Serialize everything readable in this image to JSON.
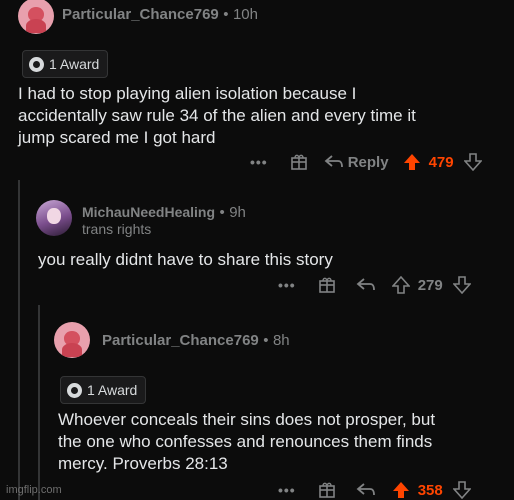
{
  "comments": [
    {
      "username": "Particular_Chance769",
      "separator": "•",
      "age": "10h",
      "award": "1 Award",
      "body_lines": [
        "I had to stop playing alien isolation because I",
        "accidentally saw rule 34 of the alien and every time it",
        "jump scared me I got hard"
      ],
      "actions": {
        "more": "•••",
        "reply": "Reply",
        "score": "479",
        "upvoted": true
      }
    },
    {
      "username": "MichauNeedHealing",
      "separator": "•",
      "age": "9h",
      "flair": "trans rights",
      "body_lines": [
        "you really didnt have to share this story"
      ],
      "actions": {
        "more": "•••",
        "score": "279",
        "upvoted": false
      }
    },
    {
      "username": "Particular_Chance769",
      "separator": "•",
      "age": "8h",
      "award": "1 Award",
      "body_lines": [
        "Whoever conceals their sins does not prosper, but",
        "the one who confesses and renounces them finds",
        "mercy. Proverbs 28:13"
      ],
      "actions": {
        "more": "•••",
        "score": "358",
        "upvoted": true
      }
    }
  ],
  "watermark": "imgflip.com",
  "colors": {
    "background": "#0c0c0c",
    "upvote": "#ff4500",
    "muted": "#818384",
    "text": "#e4e6e8"
  }
}
